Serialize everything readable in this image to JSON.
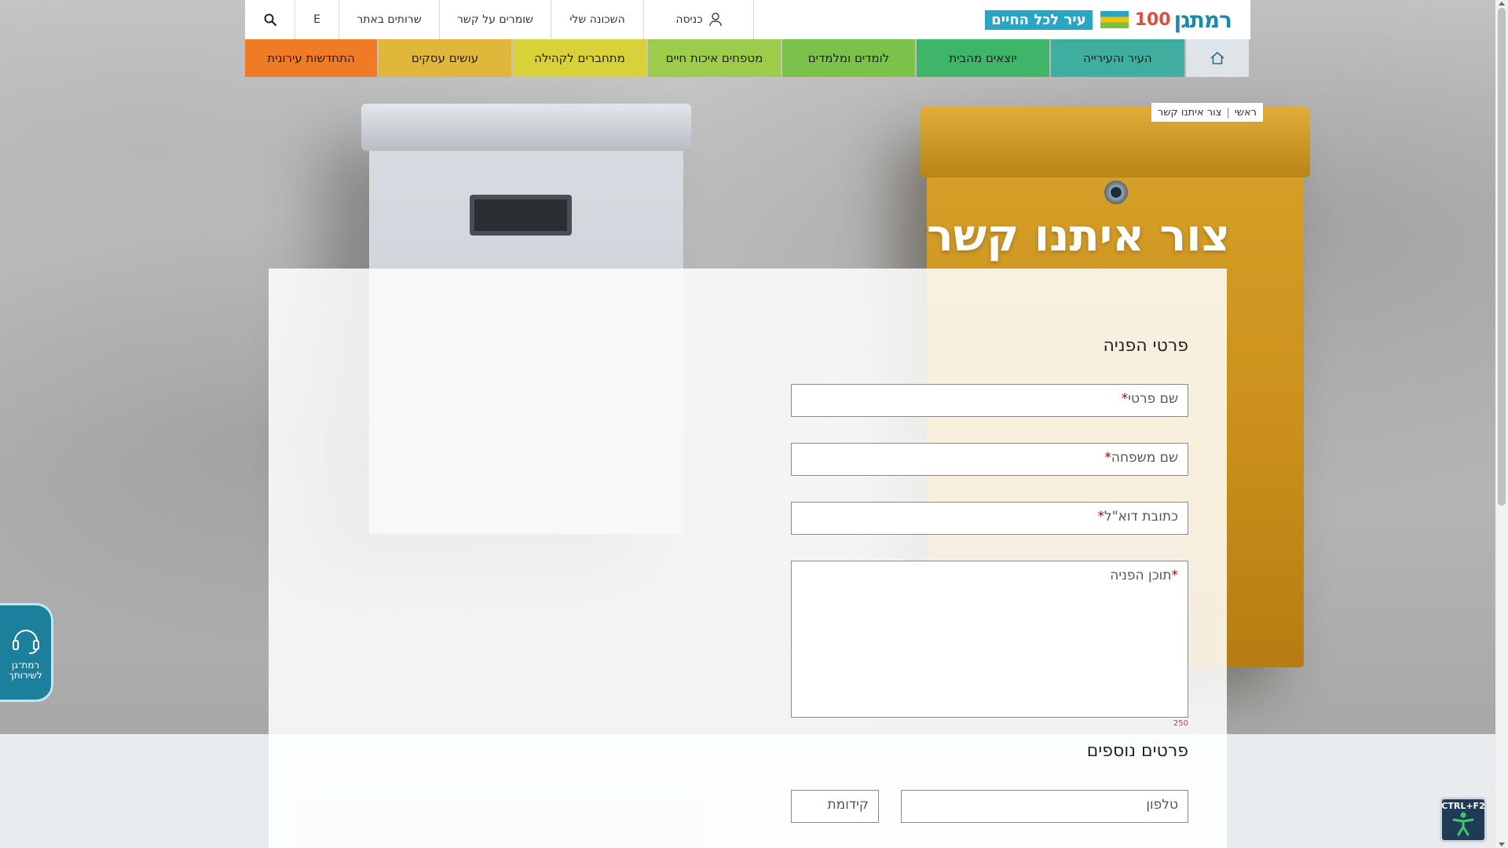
{
  "header": {
    "logo": {
      "brand": "רמתגן",
      "hundred": "100",
      "tagline": "עיר לכל החיים"
    },
    "util_links": [
      {
        "label": "כניסה",
        "icon": "user-icon"
      },
      {
        "label": "השכונה שלי"
      },
      {
        "label": "שומרים על קשר"
      },
      {
        "label": "שרותים באתר"
      },
      {
        "label": "E"
      },
      {
        "label": "",
        "icon": "search-icon"
      }
    ]
  },
  "nav": {
    "home_icon": "home-icon",
    "items": [
      {
        "label": "העיר והעירייה",
        "color": "#3fae9e"
      },
      {
        "label": "יוצאים מהבית",
        "color": "#3fb56a"
      },
      {
        "label": "לומדים ומלמדים",
        "color": "#7bc24a"
      },
      {
        "label": "מטפחים איכות חיים",
        "color": "#9ccc4a"
      },
      {
        "label": "מתחברים לקהילה",
        "color": "#d8d13a"
      },
      {
        "label": "עושים עסקים",
        "color": "#e0b73a"
      },
      {
        "label": "התחדשות עירונית",
        "color": "#f07b24"
      }
    ]
  },
  "breadcrumb": {
    "home": "ראשי",
    "current": "צור איתנו קשר"
  },
  "page": {
    "title": "צור איתנו קשר"
  },
  "form": {
    "section1_title": "פרטי הפניה",
    "first_name": "שם פרטי",
    "last_name": "שם משפחה",
    "email": "כתובת דוא\"ל",
    "message": "תוכן הפניה",
    "counter": "250",
    "section2_title": "פרטים נוספים",
    "phone": "טלפון",
    "prefix": "קידומת",
    "required_mark": "*"
  },
  "widgets": {
    "service_label": "רמת־גן לשירותך",
    "accessibility_shortcut": "CTRL+F2"
  }
}
